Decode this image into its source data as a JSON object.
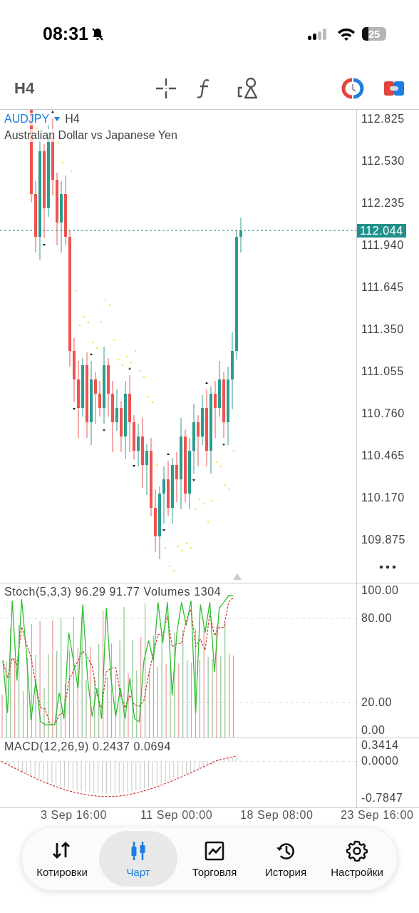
{
  "status_bar": {
    "time": "08:31",
    "battery": "25"
  },
  "toolbar": {
    "timeframe": "H4"
  },
  "chart": {
    "symbol": "AUDJPY",
    "timeframe": "H4",
    "description": "Australian Dollar vs Japanese Yen",
    "price_labels": [
      "112.825",
      "112.530",
      "112.235",
      "111.940",
      "111.645",
      "111.350",
      "111.055",
      "110.760",
      "110.465",
      "110.170",
      "109.875"
    ],
    "current_price": "112.044"
  },
  "stochastic": {
    "legend": "Stoch(5,3,3) 96.29 91.77 Volumes 1304",
    "labels": [
      "100.00",
      "80.00",
      "20.00",
      "0.00"
    ]
  },
  "macd": {
    "legend": "MACD(12,26,9) 0.2437 0.0694",
    "labels": [
      "0.3414",
      "0.0000",
      "-0.7847"
    ]
  },
  "time_axis": [
    "3 Sep 16:00",
    "11 Sep 00:00",
    "18 Sep 08:00",
    "23 Sep 16:00"
  ],
  "nav": [
    {
      "kind": "quotes",
      "label": "Котировки",
      "selected": false
    },
    {
      "kind": "chart",
      "label": "Чарт",
      "selected": true
    },
    {
      "kind": "trade",
      "label": "Торговля",
      "selected": false
    },
    {
      "kind": "history",
      "label": "История",
      "selected": false
    },
    {
      "kind": "settings",
      "label": "Настройки",
      "selected": false
    }
  ]
}
